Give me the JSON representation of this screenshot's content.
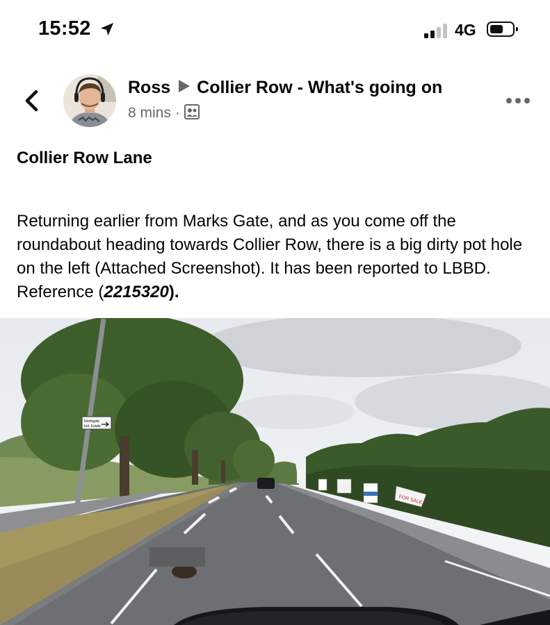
{
  "status_bar": {
    "time": "15:52",
    "network": "4G",
    "location_icon": "location-arrow-icon",
    "signal_icon": "cellular-signal-icon",
    "battery_icon": "battery-icon"
  },
  "post": {
    "author": "Ross",
    "group": "Collier Row - What's going on",
    "time_ago": "8 mins",
    "separator": "·",
    "title": "Collier Row Lane",
    "body_text": "Returning earlier from Marks Gate, and as you come off the roundabout heading towards Collier Row, there is a big dirty pot hole on the left (Attached Screenshot). It has been reported to LBBD. Reference (",
    "reference": "2215320",
    "body_tail": ").",
    "sign_text_1": "Northgate",
    "sign_text_2": "Ind. Estate",
    "banner_text": "FOR SALE"
  },
  "colors": {
    "text": "#050505",
    "secondary": "#65676b",
    "background": "#ffffff"
  }
}
